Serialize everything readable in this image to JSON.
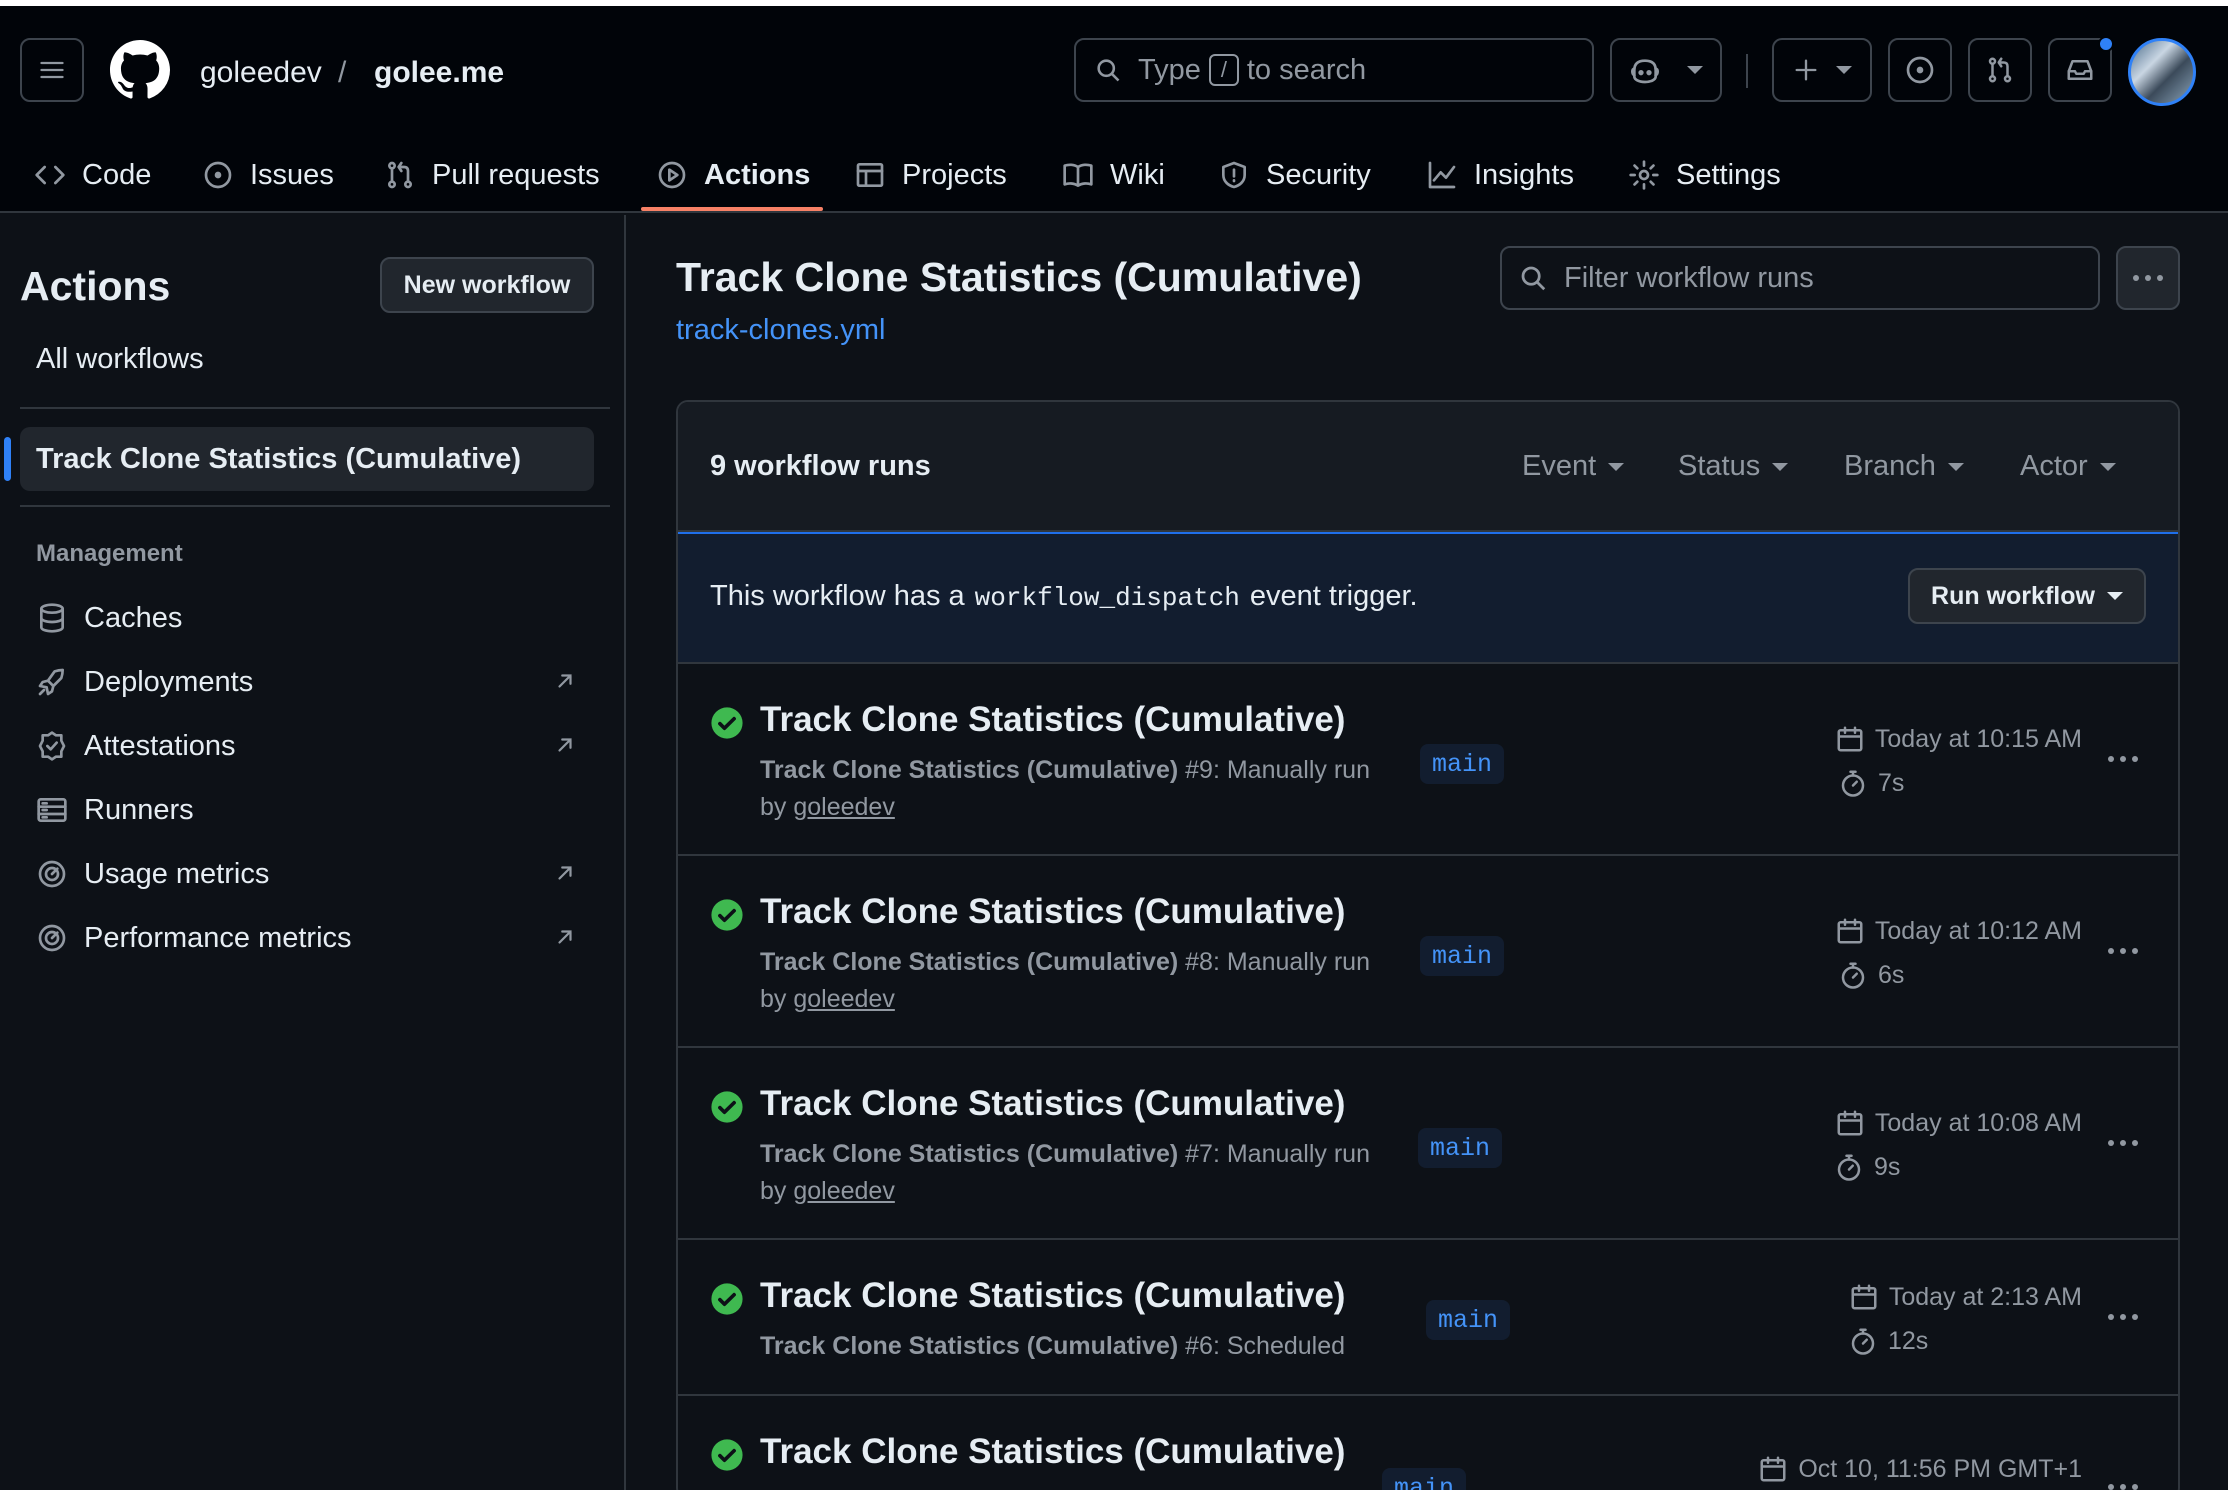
{
  "header": {
    "owner": "goleedev",
    "separator": "/",
    "repo": "golee.me",
    "search": {
      "prefix": "Type",
      "key": "/",
      "suffix": "to search"
    }
  },
  "tabs": [
    {
      "label": "Code",
      "icon": "code-icon"
    },
    {
      "label": "Issues",
      "icon": "issue-icon"
    },
    {
      "label": "Pull requests",
      "icon": "pull-request-icon"
    },
    {
      "label": "Actions",
      "icon": "play-icon",
      "active": true
    },
    {
      "label": "Projects",
      "icon": "table-icon"
    },
    {
      "label": "Wiki",
      "icon": "book-icon"
    },
    {
      "label": "Security",
      "icon": "shield-icon"
    },
    {
      "label": "Insights",
      "icon": "graph-icon"
    },
    {
      "label": "Settings",
      "icon": "gear-icon"
    }
  ],
  "sidebar": {
    "title": "Actions",
    "new_workflow": "New workflow",
    "all_workflows": "All workflows",
    "active_workflow": "Track Clone Statistics (Cumulative)",
    "management_heading": "Management",
    "items": [
      {
        "label": "Caches",
        "icon": "database-icon",
        "external": false
      },
      {
        "label": "Deployments",
        "icon": "rocket-icon",
        "external": true
      },
      {
        "label": "Attestations",
        "icon": "verified-icon",
        "external": true
      },
      {
        "label": "Runners",
        "icon": "server-icon",
        "external": false
      },
      {
        "label": "Usage metrics",
        "icon": "meter-icon",
        "external": true
      },
      {
        "label": "Performance metrics",
        "icon": "meter-icon",
        "external": true
      }
    ]
  },
  "main": {
    "title": "Track Clone Statistics (Cumulative)",
    "file": "track-clones.yml",
    "filter_placeholder": "Filter workflow runs",
    "runs_count": "9 workflow runs",
    "filters": [
      "Event",
      "Status",
      "Branch",
      "Actor"
    ],
    "banner": {
      "before": "This workflow has a",
      "code": "workflow_dispatch",
      "after": "event trigger."
    },
    "run_workflow": "Run workflow",
    "runs": [
      {
        "title": "Track Clone Statistics (Cumulative)",
        "workflow": "Track Clone Statistics (Cumulative)",
        "number": "#9",
        "trigger": "Manually run",
        "by": "by",
        "actor": "goleedev",
        "branch": "main",
        "when": "Today at 10:15 AM",
        "duration": "7s"
      },
      {
        "title": "Track Clone Statistics (Cumulative)",
        "workflow": "Track Clone Statistics (Cumulative)",
        "number": "#8",
        "trigger": "Manually run",
        "by": "by",
        "actor": "goleedev",
        "branch": "main",
        "when": "Today at 10:12 AM",
        "duration": "6s"
      },
      {
        "title": "Track Clone Statistics (Cumulative)",
        "workflow": "Track Clone Statistics (Cumulative)",
        "number": "#7",
        "trigger": "Manually run",
        "by": "by",
        "actor": "goleedev",
        "branch": "main",
        "when": "Today at 10:08 AM",
        "duration": "9s"
      },
      {
        "title": "Track Clone Statistics (Cumulative)",
        "workflow": "Track Clone Statistics (Cumulative)",
        "number": "#6",
        "trigger": "Scheduled",
        "by": "",
        "actor": "",
        "branch": "main",
        "when": "Today at 2:13 AM",
        "duration": "12s"
      },
      {
        "title": "Track Clone Statistics (Cumulative)",
        "workflow": "",
        "number": "",
        "trigger": "",
        "by": "",
        "actor": "",
        "branch": "main",
        "when": "Oct 10, 11:56 PM GMT+1",
        "duration": ""
      }
    ]
  },
  "colors": {
    "accent": "#f78166",
    "link": "#4493f8",
    "success": "#3fb950",
    "bg": "#0d1117"
  }
}
